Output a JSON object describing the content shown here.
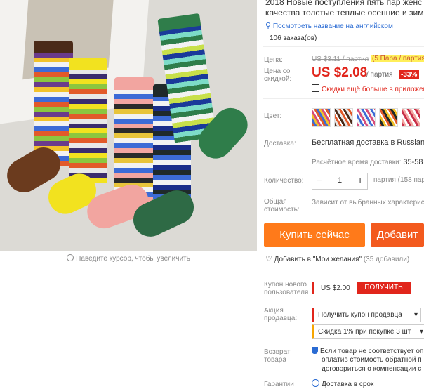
{
  "title": {
    "line1": "2018 Новые поступления пять пар женс",
    "line2": "качества толстые теплые осенние и зим"
  },
  "translate_link": "Посмотреть название на английском",
  "orders": "106 заказа(ов)",
  "price": {
    "label": "Цена:",
    "old": "US $3.11 / партия",
    "pack": "(5 Пара / партия",
    "discount_label": "Цена со скидкой:",
    "value": "US $2.08",
    "unit": "/ партия",
    "badge": "-33%",
    "more_discounts": "Скидки ещё больше в приложен"
  },
  "color": {
    "label": "Цвет:",
    "count": 6
  },
  "delivery": {
    "label": "Доставка:",
    "value": "Бесплатная доставка в Russian Fe",
    "time_label": "Расчётное время доставки:",
    "time_value": "35-58"
  },
  "quantity": {
    "label": "Количество:",
    "minus": "−",
    "value": "1",
    "plus": "+",
    "note": "партия (158 пар"
  },
  "total": {
    "label": "Общая стоимость:",
    "value": "Зависит от выбранных характерис"
  },
  "buttons": {
    "buy": "Купить сейчас",
    "add": "Добавит"
  },
  "wishlist": {
    "text": "Добавить в \"Мои желания\"",
    "count": "(35 добавили)"
  },
  "coupon": {
    "label": "Купон нового пользователя",
    "value": "US $2.00",
    "get": "ПОЛУЧИТЬ"
  },
  "promo": {
    "label": "Акция продавца:",
    "option1": "Получить купон продавца",
    "option2": "Скидка 1% при покупке 3 шт."
  },
  "returns": {
    "label": "Возврат товара",
    "line1": "Если товар не соответствует оп",
    "line2": "оплатив стоимость обратной п",
    "line3": "договориться о компенсации с"
  },
  "guarantee": {
    "label": "Гарантии",
    "value": "Доставка в срок"
  },
  "zoom_hint": "Наведите курсор, чтобы увеличить",
  "colors": {
    "accent": "#ff7a1a",
    "sale": "#e1251b",
    "link": "#2a6bd3"
  }
}
